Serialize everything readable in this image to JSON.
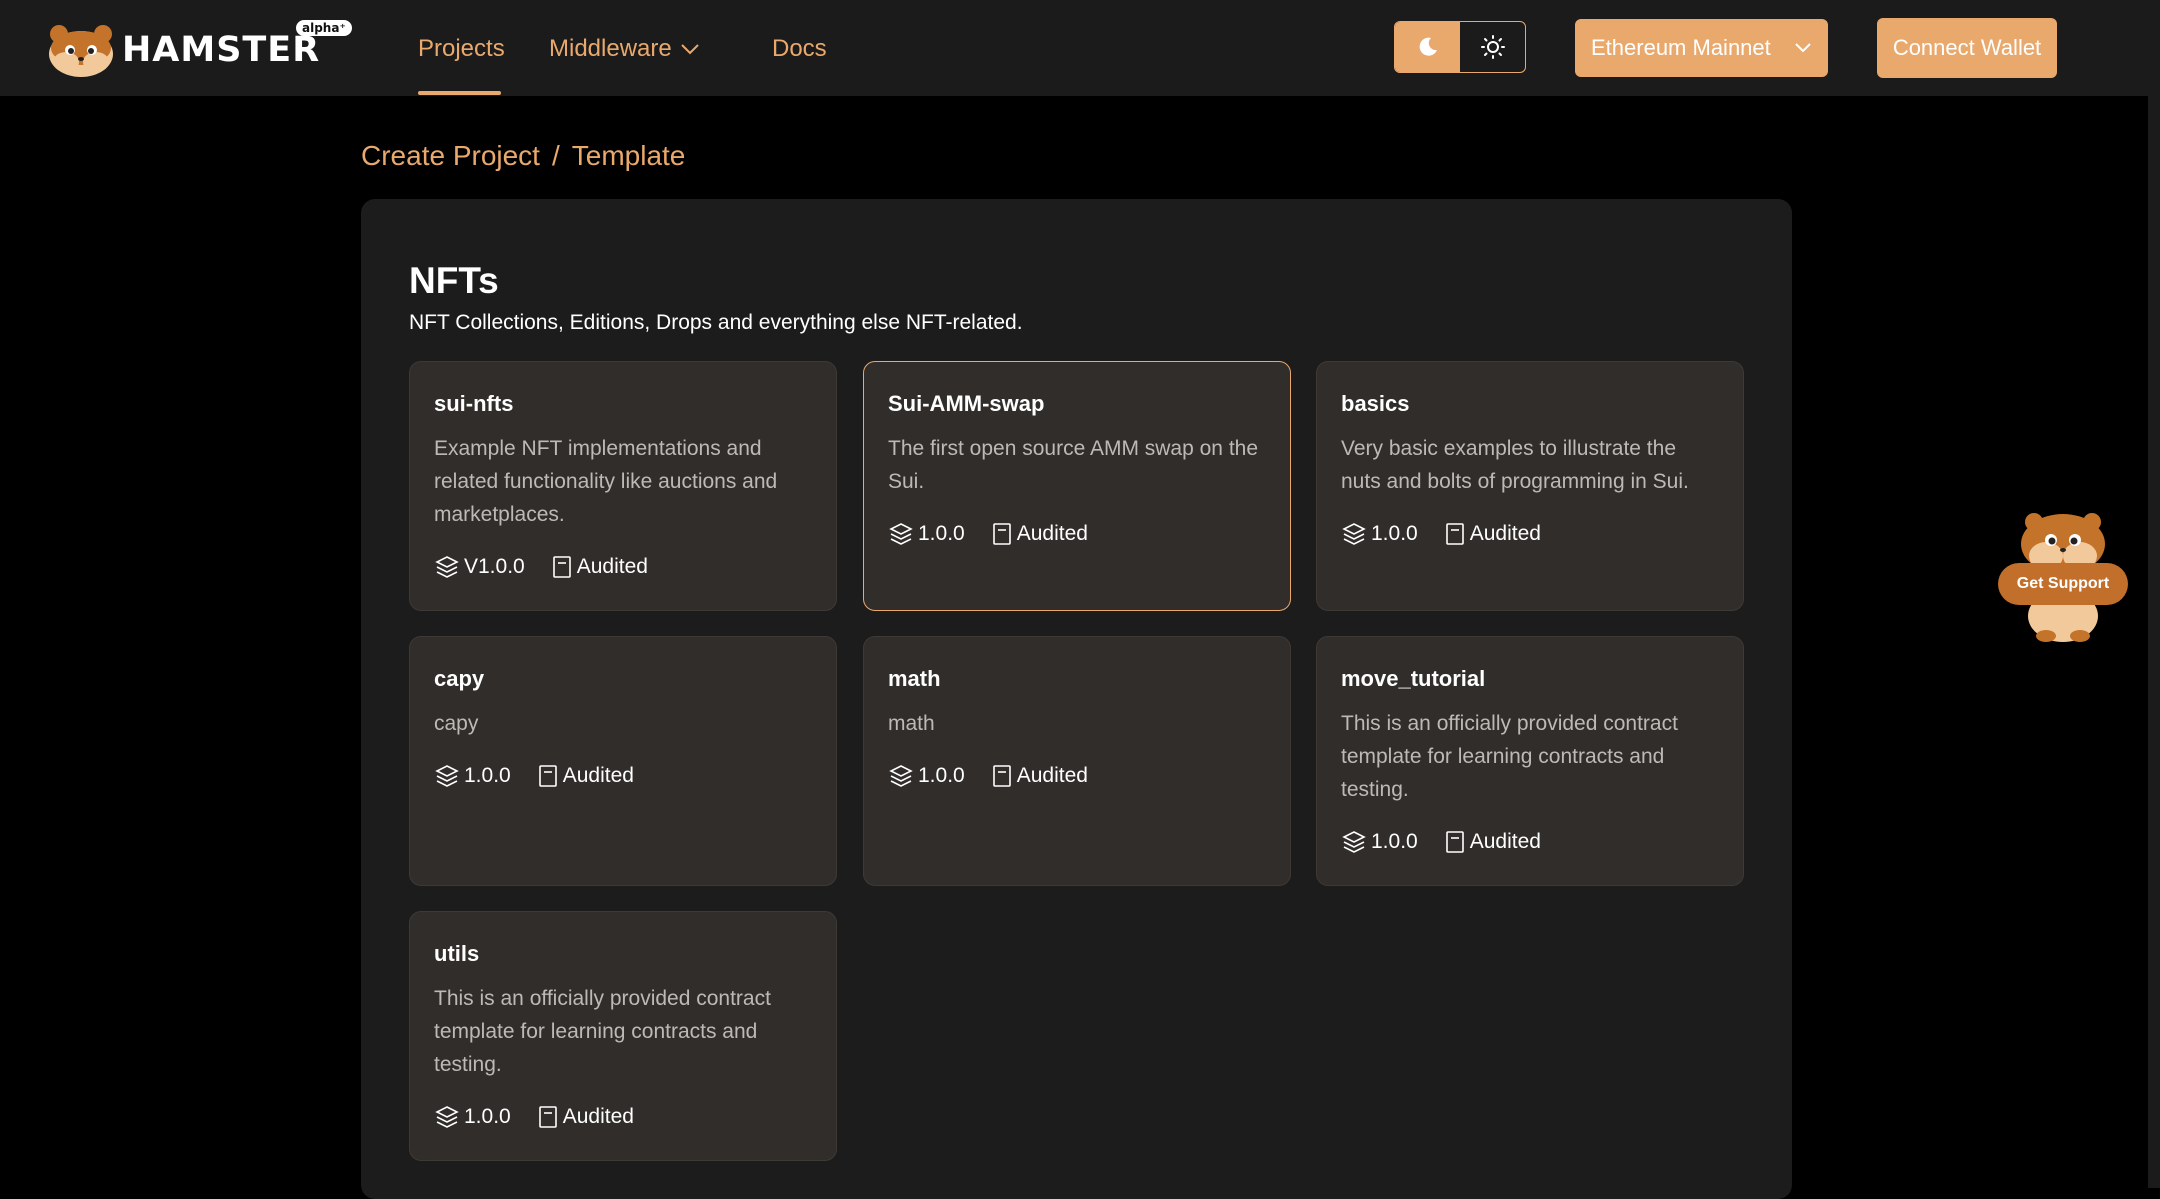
{
  "header": {
    "logo_text": "HAMSTER",
    "logo_badge": "alpha⁺",
    "nav": {
      "projects": "Projects",
      "middleware": "Middleware",
      "docs": "Docs"
    },
    "network_select": "Ethereum Mainnet",
    "connect_wallet": "Connect Wallet"
  },
  "breadcrumb": {
    "parent": "Create Project",
    "separator": "/",
    "current": "Template"
  },
  "section": {
    "title": "NFTs",
    "subtitle": "NFT Collections, Editions, Drops and everything else NFT-related."
  },
  "templates": [
    {
      "name": "sui-nfts",
      "description": "Example NFT implementations and related functionality like auctions and marketplaces.",
      "version": "V1.0.0",
      "status": "Audited"
    },
    {
      "name": "Sui-AMM-swap",
      "description": "The first open source AMM swap on the Sui.",
      "version": "1.0.0",
      "status": "Audited"
    },
    {
      "name": "basics",
      "description": "Very basic examples to illustrate the nuts and bolts of programming in Sui.",
      "version": "1.0.0",
      "status": "Audited"
    },
    {
      "name": "capy",
      "description": "capy",
      "version": "1.0.0",
      "status": "Audited"
    },
    {
      "name": "math",
      "description": "math",
      "version": "1.0.0",
      "status": "Audited"
    },
    {
      "name": "move_tutorial",
      "description": "This is an officially provided contract template for learning contracts and testing.",
      "version": "1.0.0",
      "status": "Audited"
    },
    {
      "name": "utils",
      "description": "This is an officially provided contract template for learning contracts and testing.",
      "version": "1.0.0",
      "status": "Audited"
    }
  ],
  "support": {
    "label": "Get Support"
  },
  "colors": {
    "accent": "#e9a96d",
    "background": "#000000",
    "header_bg": "#1b1b1b",
    "panel_bg": "#1c1c1c",
    "card_bg": "#302d2a",
    "muted_text": "#bdbab6"
  }
}
